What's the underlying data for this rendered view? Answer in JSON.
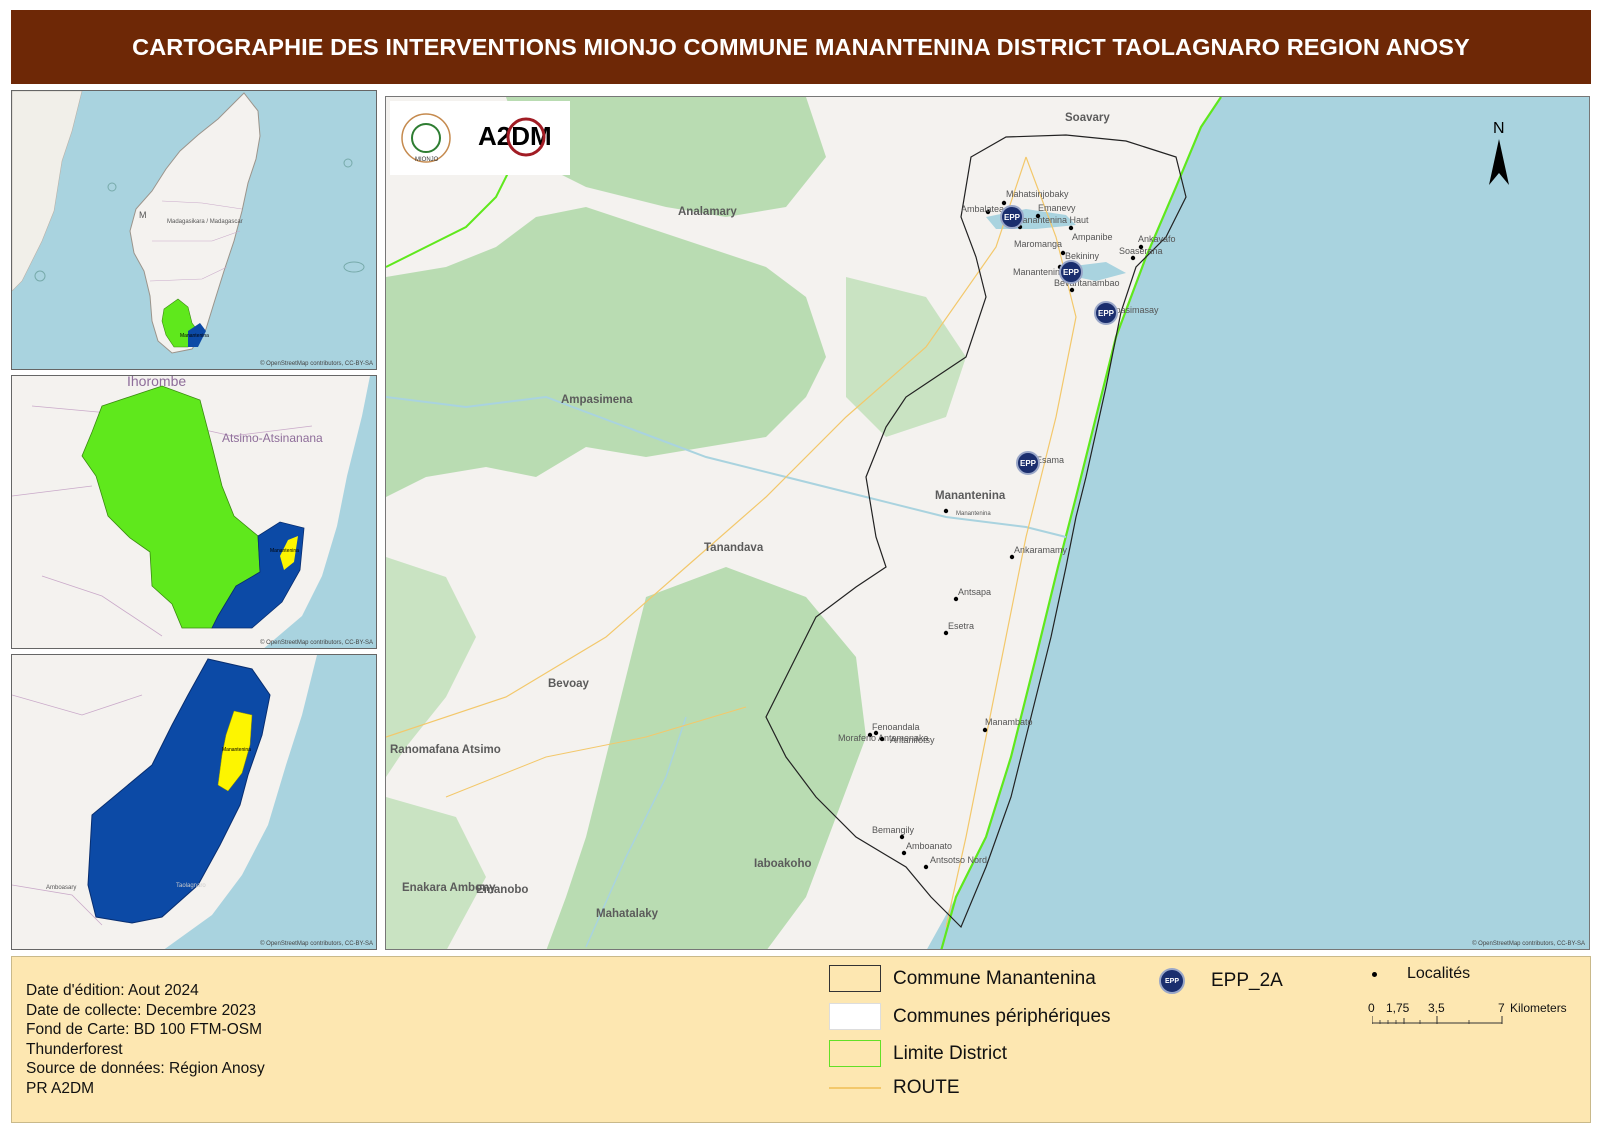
{
  "title": "CARTOGRAPHIE DES INTERVENTIONS MIONJO COMMUNE MANANTENINA DISTRICT TAOLAGNARO REGION ANOSY",
  "insets": {
    "madagascar": {
      "labels": [
        "Madagasikara / Madagascar",
        "M",
        "Manantenina"
      ],
      "credits": "© OpenStreetMap contributors, CC-BY-SA"
    },
    "region": {
      "labels": [
        "Ihorombe",
        "Atsimo-Atsinanana",
        "Manantenina"
      ],
      "credits": "© OpenStreetMap contributors, CC-BY-SA"
    },
    "district": {
      "labels": [
        "Manantenina",
        "Amboasary",
        "Taolagnaro"
      ],
      "credits": "© OpenStreetMap contributors, CC-BY-SA"
    }
  },
  "logos": {
    "mionjo": "MIONJO",
    "a2dm": "A2DM"
  },
  "main_map": {
    "north_label": "N",
    "credits": "© OpenStreetMap contributors, CC-BY-SA",
    "region_labels": [
      "Soavary",
      "Analamary",
      "Ampasimena",
      "Tanandava",
      "Bevoay",
      "Ranomafana Atsimo",
      "Iaboakoho",
      "Emanobo",
      "Enakara Ambony",
      "Mahatalaky",
      "Manantenina"
    ],
    "localities": [
      "Mahatsinjobaky",
      "Ambalatea",
      "Emanevy",
      "Manantenina Haut",
      "Ampanibe",
      "Maromanga",
      "Bekininy",
      "Manantenina",
      "Bevantanambao",
      "Ankavafo",
      "Soaserana",
      "Ampasimasay",
      "Esama",
      "Manantenina",
      "Ankaramamy",
      "Antsapa",
      "Esetra",
      "Manambato",
      "Fenoandala",
      "Morafeno Antamenaka",
      "Antanifotsy",
      "Bemangily",
      "Amboanato",
      "Antsotso Nord"
    ],
    "epp_label": "EPP"
  },
  "legend": {
    "meta": [
      "Date d'édition: Aout 2024",
      "Date de collecte: Decembre 2023",
      "Fond de Carte: BD 100 FTM-OSM",
      "Thunderforest",
      "Source de données: Région Anosy",
      "PR A2DM"
    ],
    "items": {
      "commune": "Commune Manantenina",
      "periph": "Communes périphériques",
      "limite": "Limite District",
      "route": "ROUTE",
      "epp": "EPP_2A",
      "localites": "Localités"
    },
    "epp_symbol_text": "EPP",
    "scale": {
      "ticks": [
        "0",
        "1,75",
        "3,5",
        "7"
      ],
      "unit": "Kilometers"
    }
  },
  "colors": {
    "title_bg": "#6e2806",
    "sea": "#a9d3df",
    "land": "#f4f2ef",
    "forest": "#b9dcb2",
    "district_green": "#5fe81c",
    "district_blue": "#0c4aa6",
    "commune_yellow": "#fdf500",
    "legend_bg": "#fde7b1",
    "epp": "#1a2e6e"
  }
}
